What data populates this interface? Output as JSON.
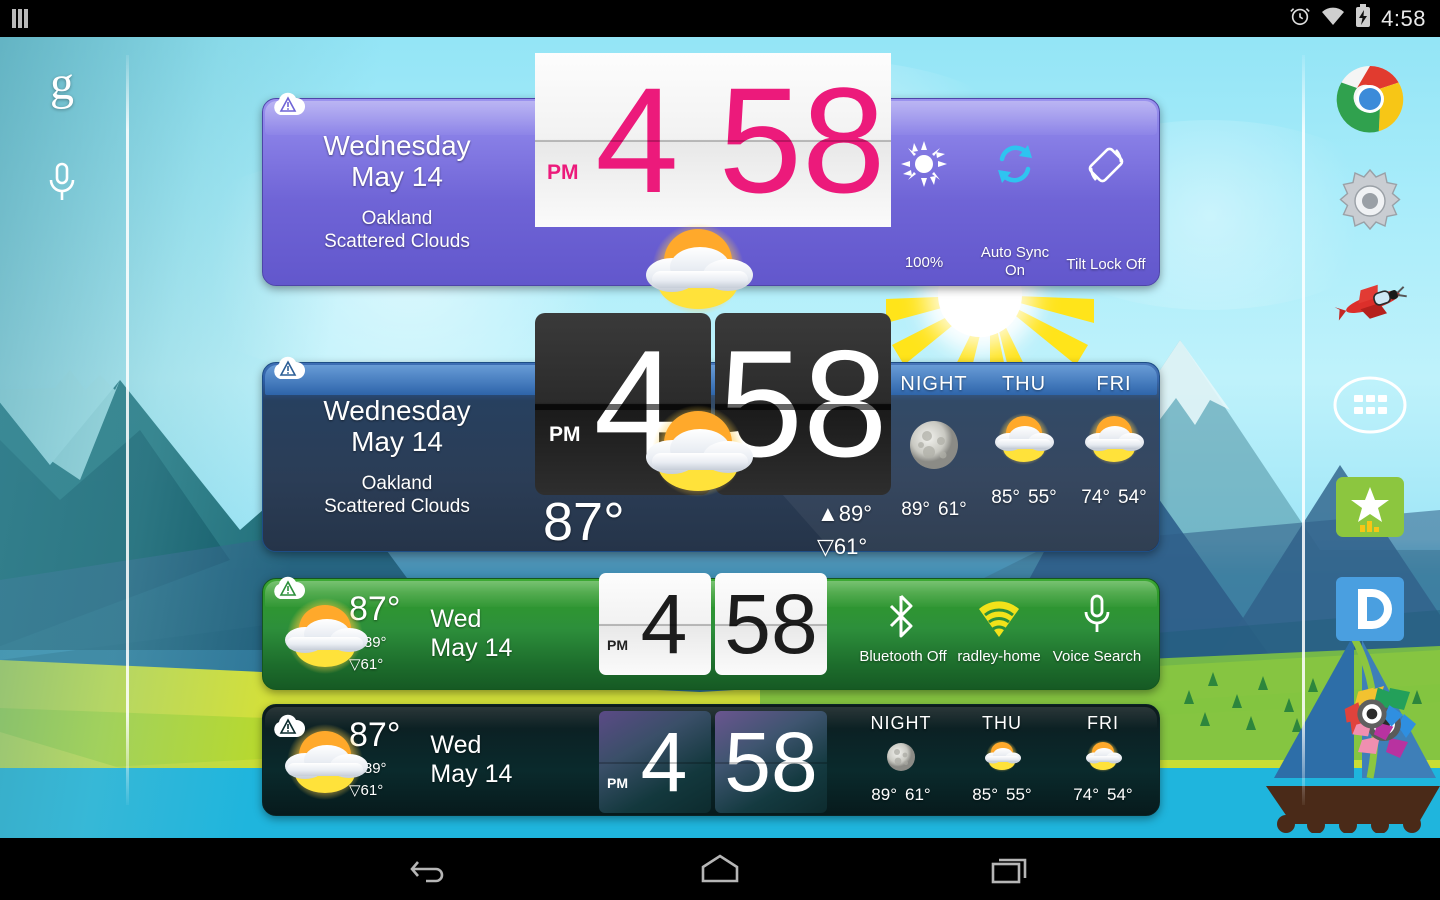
{
  "status_bar": {
    "time": "4:58",
    "icons": [
      "alarm-icon",
      "wifi-icon",
      "battery-charging-icon"
    ],
    "notification_icon": "notification-bars-icon"
  },
  "nav_bar": {
    "back": "back-icon",
    "home": "home-icon",
    "recents": "recents-icon"
  },
  "left_dock": {
    "google": "g",
    "voice": "microphone-icon"
  },
  "right_dock": [
    {
      "name": "chrome-icon",
      "label": "Chrome"
    },
    {
      "name": "settings-gear-icon",
      "label": "Settings"
    },
    {
      "name": "airplane-icon",
      "label": "Airplane"
    },
    {
      "name": "app-drawer-icon",
      "label": "Apps"
    },
    {
      "name": "star-chart-icon",
      "label": "Star"
    },
    {
      "name": "letter-d-icon",
      "label": "D"
    },
    {
      "name": "color-ring-icon",
      "label": "Gallery"
    }
  ],
  "weather": {
    "day_long": "Wednesday",
    "day_short": "Wed",
    "date": "May 14",
    "city": "Oakland",
    "condition": "Scattered Clouds",
    "temp": "87°",
    "high": "89°",
    "low": "61°",
    "high_arrow": "▲",
    "low_arrow": "▽",
    "condition_icon": "sun-behind-cloud-icon"
  },
  "clock": {
    "hour": "4",
    "minute": "58",
    "meridiem": "PM"
  },
  "forecast": [
    {
      "day": "NIGHT",
      "icon": "moon-icon",
      "high": "89°",
      "low": "61°"
    },
    {
      "day": "THU",
      "icon": "sun-behind-cloud-icon",
      "high": "85°",
      "low": "55°"
    },
    {
      "day": "FRI",
      "icon": "sun-behind-cloud-icon",
      "high": "74°",
      "low": "54°"
    }
  ],
  "widget1": {
    "toggles": [
      {
        "icon": "brightness-sun-icon",
        "label": "100%"
      },
      {
        "icon": "auto-sync-icon",
        "label": "Auto Sync\nOn"
      },
      {
        "icon": "tilt-lock-icon",
        "label": "Tilt Lock Off"
      }
    ],
    "toggle_labels": {
      "brightness": "100%",
      "sync": "Auto Sync On",
      "tilt": "Tilt Lock Off"
    },
    "sync_line1": "Auto Sync",
    "sync_line2": "On"
  },
  "widget3": {
    "connections": [
      {
        "icon": "bluetooth-icon",
        "label": "Bluetooth Off"
      },
      {
        "icon": "wifi-signal-icon",
        "label": "radley-home"
      },
      {
        "icon": "microphone-icon",
        "label": "Voice Search"
      }
    ]
  },
  "colors": {
    "widget1_bg": "#6f64d6",
    "widget2_bg": "#2b3d56",
    "widget3_bg": "#2d8f3b",
    "widget4_bg": "#0a2a2c",
    "clock_pink": "#ec1a7b",
    "sky": "#a8ecfa",
    "water": "#2ab4dd",
    "grass": "#8cc63f"
  }
}
